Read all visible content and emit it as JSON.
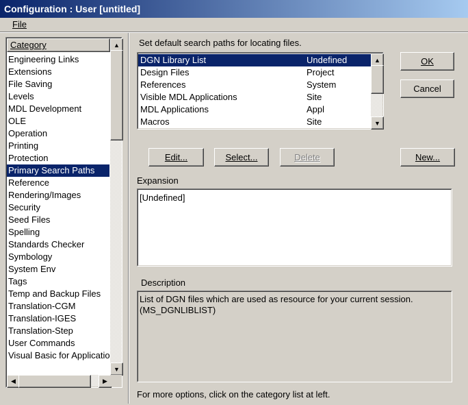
{
  "window": {
    "title": "Configuration : User [untitled]"
  },
  "menu": {
    "file": "File"
  },
  "category": {
    "header": "Category",
    "selected_index": 9,
    "items": [
      "Engineering Links",
      "Extensions",
      "File Saving",
      "Levels",
      "MDL Development",
      "OLE",
      "Operation",
      "Printing",
      "Protection",
      "Primary Search Paths",
      "Reference",
      "Rendering/Images",
      "Security",
      "Seed Files",
      "Spelling",
      "Standards Checker",
      "Symbology",
      "System Env",
      "Tags",
      "Temp and Backup Files",
      "Translation-CGM",
      "Translation-IGES",
      "Translation-Step",
      "User Commands",
      "Visual Basic for Applications"
    ]
  },
  "paths": {
    "heading": "Set default search paths for locating files.",
    "selected_index": 0,
    "rows": [
      {
        "name": "DGN Library List",
        "value": "Undefined"
      },
      {
        "name": "Design Files",
        "value": "Project"
      },
      {
        "name": "References",
        "value": "System"
      },
      {
        "name": "Visible MDL Applications",
        "value": "Site"
      },
      {
        "name": "MDL Applications",
        "value": "Appl"
      },
      {
        "name": "Macros",
        "value": "Site"
      }
    ]
  },
  "buttons": {
    "ok": "OK",
    "cancel": "Cancel",
    "edit": "Edit...",
    "select": "Select...",
    "delete": "Delete",
    "new": "New..."
  },
  "expansion": {
    "label": "Expansion",
    "value": "[Undefined]"
  },
  "description": {
    "label": "Description",
    "line1": "List of DGN files which are used as resource for your current session.",
    "line2": "(MS_DGNLIBLIST)"
  },
  "footer": "For more options, click on the category list at left."
}
